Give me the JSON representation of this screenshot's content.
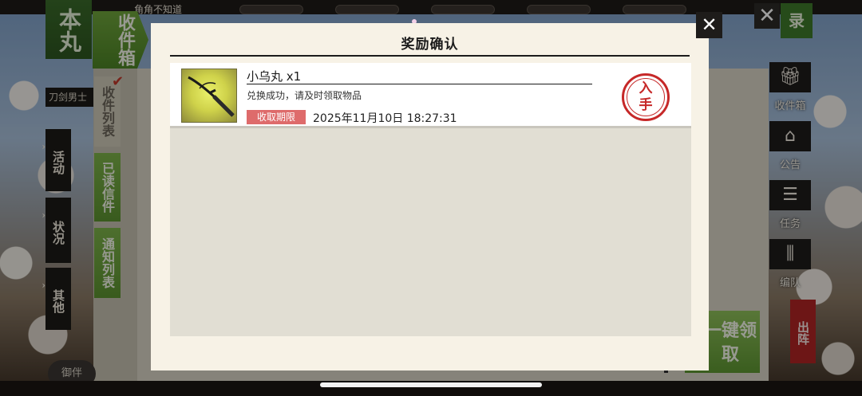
{
  "topbar": {
    "player_name": "角角不知道"
  },
  "background": {
    "honmaru_label": "本丸",
    "mailbox_label": "收件箱",
    "katana_label": "刀剑男士",
    "side_tabs": [
      {
        "label": "收件列表",
        "active": false
      },
      {
        "label": "已读信件",
        "active": true
      },
      {
        "label": "通知列表",
        "active": true
      }
    ],
    "left_menu": [
      {
        "label": "活动"
      },
      {
        "label": "状况"
      },
      {
        "label": "其他"
      }
    ],
    "right_menu": [
      {
        "icon": "gift-icon",
        "label": "收件箱"
      },
      {
        "icon": "house-icon",
        "label": "公告"
      },
      {
        "icon": "checklist-icon",
        "label": "任务"
      },
      {
        "icon": "formation-icon",
        "label": "编队"
      }
    ],
    "record_label": "录",
    "claim_all_label": "一键领取",
    "sortie_label": "出阵",
    "ceremony_label": "御伴"
  },
  "modal": {
    "title": "奖励确认",
    "close_icon": "close-icon",
    "rewards": [
      {
        "name": "小乌丸 x1",
        "description": "兑换成功，请及时领取物品",
        "deadline_label": "收取期限",
        "deadline_date": "2025年11月10日 18:27:31",
        "stamp_label": "入手",
        "thumb_icon": "katana-icon"
      }
    ]
  },
  "colors": {
    "modal_bg": "#f7f2e6",
    "stamp_red": "#c62828",
    "badge_red": "#de6b6b",
    "green_accent": "#6fa53c"
  }
}
